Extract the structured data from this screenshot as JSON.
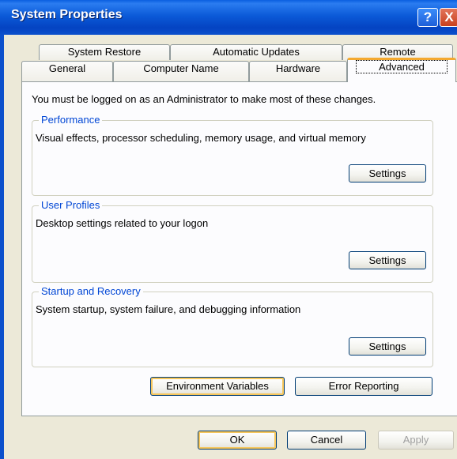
{
  "window": {
    "title": "System Properties",
    "help_glyph": "?",
    "close_glyph": "X"
  },
  "tabs": {
    "back_row": [
      "System Restore",
      "Automatic Updates",
      "Remote"
    ],
    "front_row": [
      "General",
      "Computer Name",
      "Hardware",
      "Advanced"
    ],
    "active": "Advanced"
  },
  "advanced": {
    "intro": "You must be logged on as an Administrator to make most of these changes.",
    "performance": {
      "title": "Performance",
      "description": "Visual effects, processor scheduling, memory usage, and virtual memory",
      "button": "Settings"
    },
    "user_profiles": {
      "title": "User Profiles",
      "description": "Desktop settings related to your logon",
      "button": "Settings"
    },
    "startup_recovery": {
      "title": "Startup and Recovery",
      "description": "System startup, system failure, and debugging information",
      "button": "Settings"
    },
    "environment_variables": "Environment Variables",
    "error_reporting": "Error Reporting"
  },
  "footer": {
    "ok": "OK",
    "cancel": "Cancel",
    "apply": "Apply"
  }
}
